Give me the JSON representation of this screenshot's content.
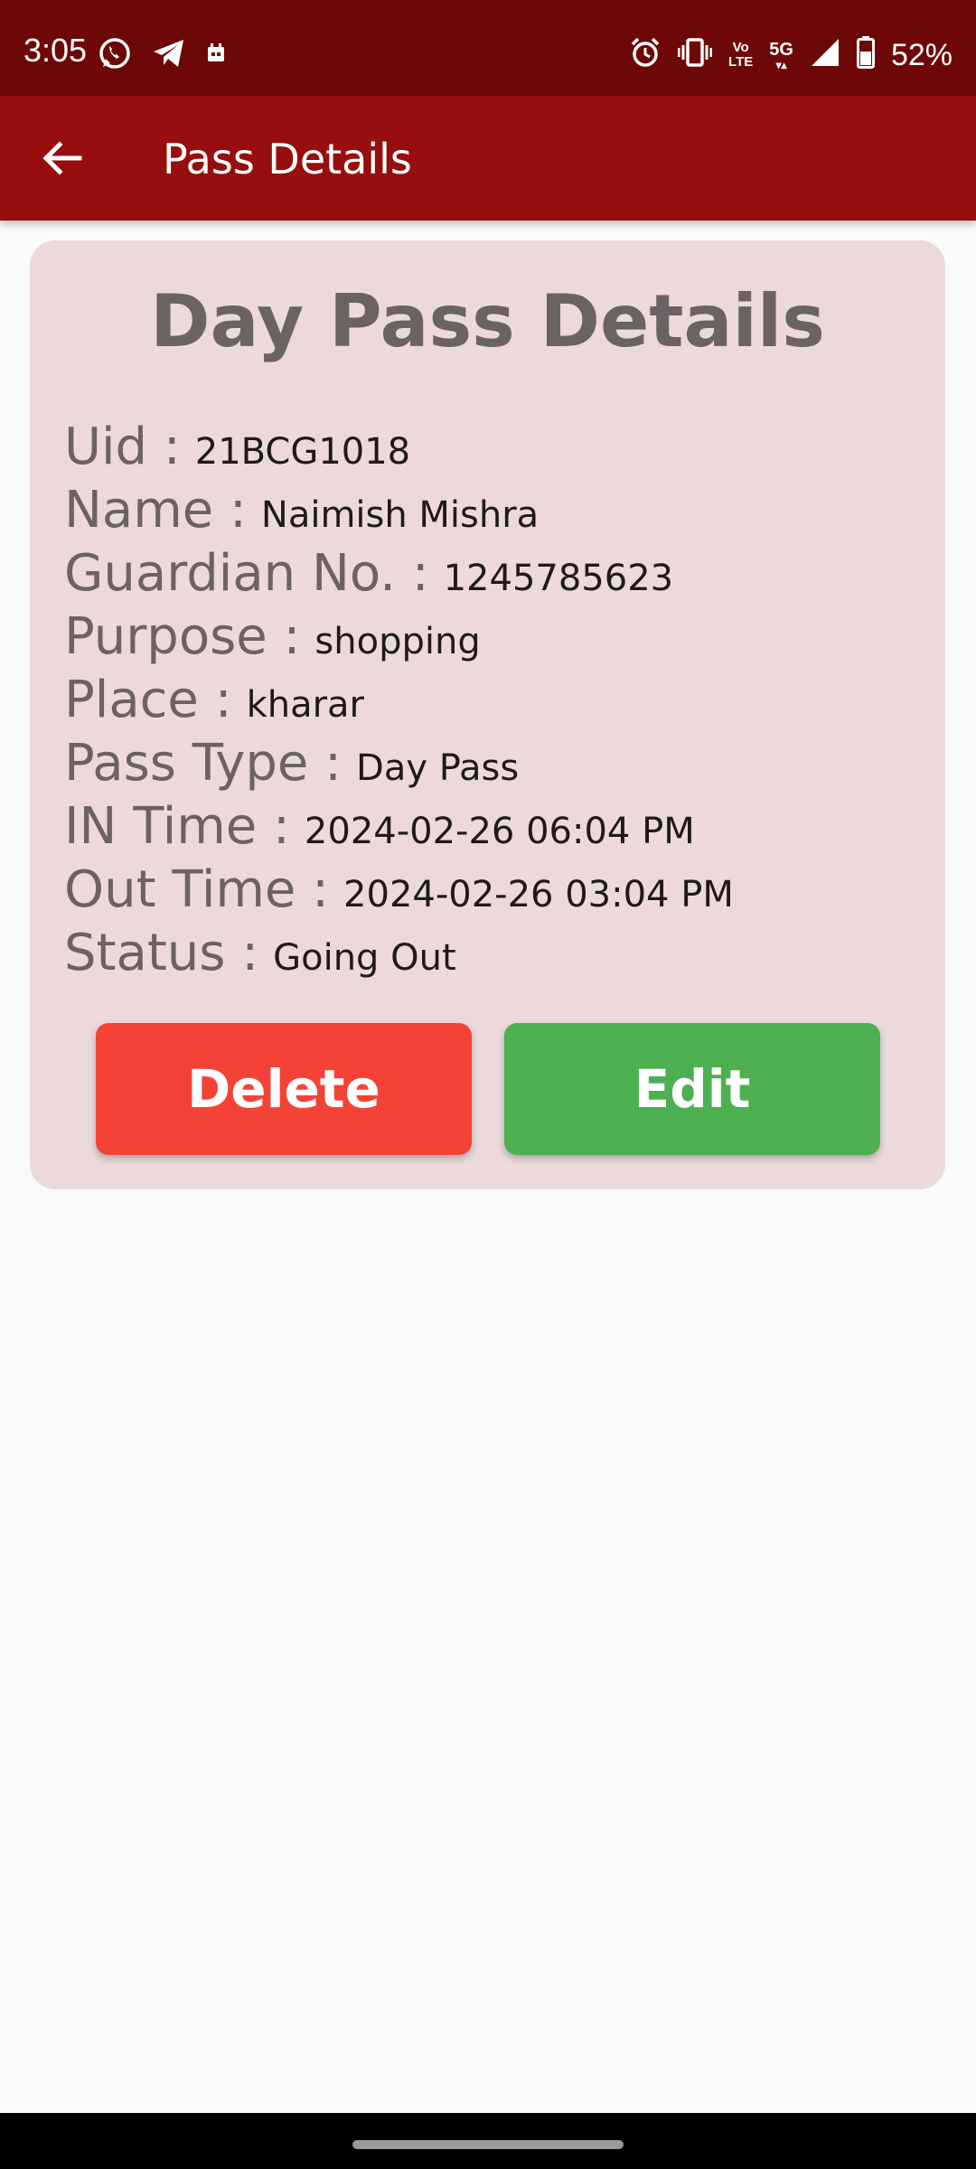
{
  "status_bar": {
    "time": "3:05",
    "battery_percent": "52%",
    "volte_label_top": "Vo",
    "volte_label_bottom": "LTE",
    "network_label": "5G"
  },
  "app_bar": {
    "title": "Pass Details"
  },
  "card": {
    "title": "Day Pass Details",
    "rows": [
      {
        "label": "Uid :",
        "value": "21BCG1018"
      },
      {
        "label": "Name :",
        "value": "Naimish Mishra"
      },
      {
        "label": "Guardian No. :",
        "value": "1245785623"
      },
      {
        "label": "Purpose :",
        "value": "shopping"
      },
      {
        "label": "Place :",
        "value": "kharar"
      },
      {
        "label": "Pass Type :",
        "value": "Day Pass"
      },
      {
        "label": "IN Time :",
        "value": "2024-02-26 06:04 PM"
      },
      {
        "label": "Out Time :",
        "value": "2024-02-26 03:04 PM"
      },
      {
        "label": "Status :",
        "value": "Going Out"
      }
    ],
    "delete_label": "Delete",
    "edit_label": "Edit"
  },
  "colors": {
    "status_bar": "#6e0808",
    "app_bar": "#960e0e",
    "card_bg": "#ecdadb",
    "delete_button": "#f44336",
    "edit_button": "#4caf50"
  }
}
